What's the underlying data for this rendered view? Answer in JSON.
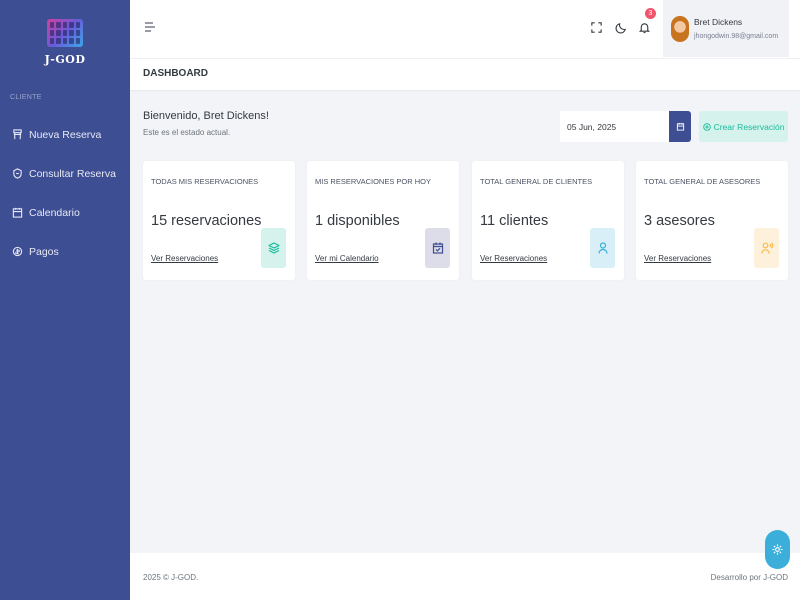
{
  "brand": {
    "name": "J-GOD"
  },
  "sidebar": {
    "section_title": "CLIENTE",
    "items": [
      {
        "label": "Nueva Reserva",
        "icon": "bookmark-icon"
      },
      {
        "label": "Consultar Reserva",
        "icon": "search-icon"
      },
      {
        "label": "Calendario",
        "icon": "calendar-icon"
      },
      {
        "label": "Pagos",
        "icon": "payment-icon"
      }
    ]
  },
  "header": {
    "notifications_count": "3",
    "user": {
      "name": "Bret Dickens",
      "email": "jhongodwin.98@gmail.com"
    }
  },
  "page": {
    "title": "DASHBOARD"
  },
  "welcome": {
    "title": "Bienvenido, Bret Dickens!",
    "subtitle": "Este es el estado actual."
  },
  "toolbar": {
    "date_value": "05 Jun, 2025",
    "create_label": "Crear Reservación"
  },
  "cards": [
    {
      "title": "TODAS MIS RESERVACIONES",
      "value": "15 reservaciones",
      "link": "Ver Reservaciones",
      "icon": "layers-icon",
      "icon_color": "#1abc9c",
      "icon_bg": "#d5f2ec"
    },
    {
      "title": "MIS RESERVACIONES POR HOY",
      "value": "1 disponibles",
      "link": "Ver mi Calendario",
      "icon": "calendar-check-icon",
      "icon_color": "#3e4e93",
      "icon_bg": "#dcdde9"
    },
    {
      "title": "TOTAL GENERAL DE CLIENTES",
      "value": "11 clientes",
      "link": "Ver Reservaciones",
      "icon": "user-icon",
      "icon_color": "#3bafda",
      "icon_bg": "#d8eff8"
    },
    {
      "title": "TOTAL GENERAL DE ASESORES",
      "value": "3 asesores",
      "link": "Ver Reservaciones",
      "icon": "user-voice-icon",
      "icon_color": "#f7b84b",
      "icon_bg": "#fdf1dc"
    }
  ],
  "footer": {
    "left": "2025 © J-GOD.",
    "right": "Desarrollo por J-GOD"
  },
  "colors": {
    "sidebar": "#3e4e93",
    "accent": "#1abc9c",
    "info": "#3bafda",
    "warning": "#f7b84b",
    "danger": "#f1556c"
  }
}
